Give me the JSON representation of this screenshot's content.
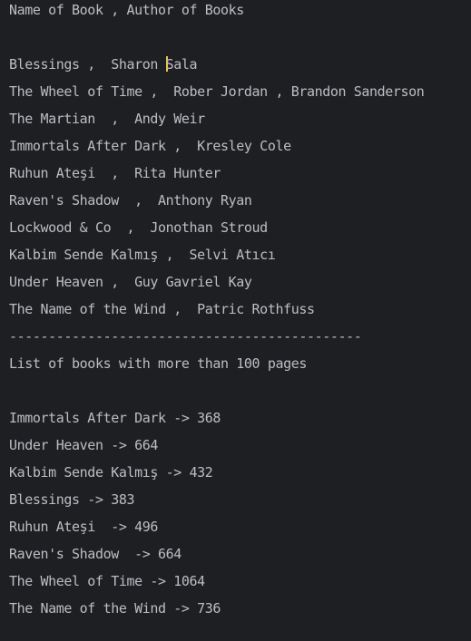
{
  "console": {
    "header": "Name of Book , Author of Books",
    "books": [
      "Blessings ,  Sharon Sala",
      "The Wheel of Time ,  Rober Jordan , Brandon Sanderson",
      "The Martian  ,  Andy Weir",
      "Immortals After Dark ,  Kresley Cole",
      "Ruhun Ateşi  ,  Rita Hunter",
      "Raven's Shadow  ,  Anthony Ryan",
      "Lockwood & Co  ,  Jonothan Stroud",
      "Kalbim Sende Kalmış ,  Selvi Atıcı",
      "Under Heaven ,  Guy Gavriel Kay",
      "The Name of the Wind ,  Patric Rothfuss"
    ],
    "separator": "---------------------------------------------",
    "filter_title": "List of books with more than 100 pages",
    "filtered": [
      "Immortals After Dark -> 368",
      "Under Heaven -> 664",
      "Kalbim Sende Kalmış -> 432",
      "Blessings -> 383",
      "Ruhun Ateşi  -> 496",
      "Raven's Shadow  -> 664",
      "The Wheel of Time -> 1064",
      "The Name of the Wind -> 736"
    ]
  },
  "colors": {
    "background": "#1e1f22",
    "text": "#bcbec4",
    "caret": "#f0c24b"
  }
}
